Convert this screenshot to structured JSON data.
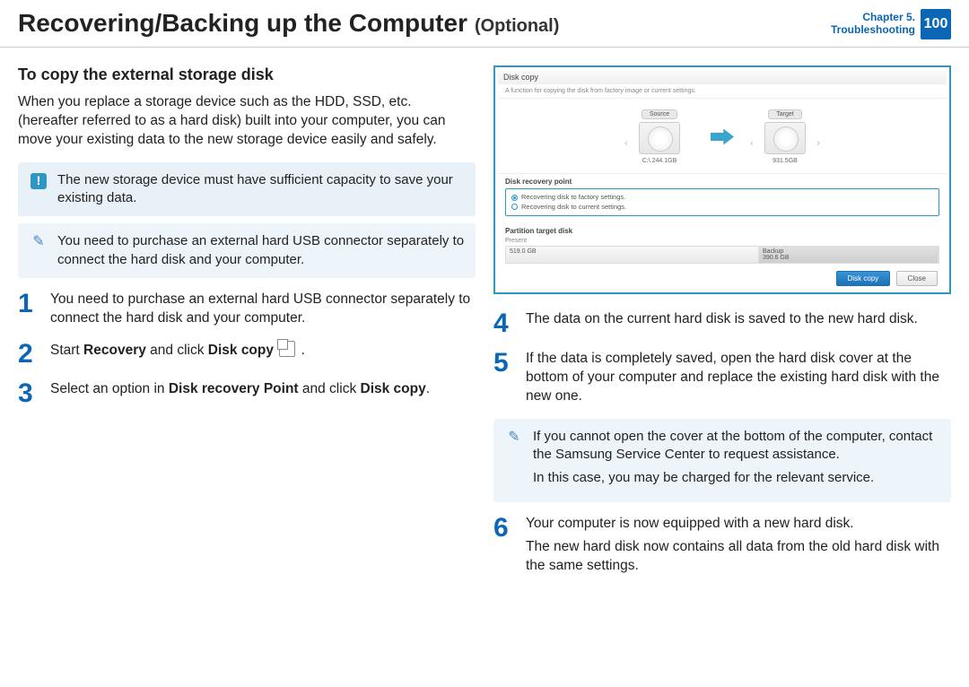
{
  "header": {
    "title": "Recovering/Backing up the Computer",
    "optional": "(Optional)",
    "chapter_line1": "Chapter 5.",
    "chapter_line2": "Troubleshooting",
    "page": "100"
  },
  "section_title": "To copy the external storage disk",
  "intro": "When you replace a storage device such as the HDD, SSD, etc. (hereafter referred to as a hard disk) built into your computer, you can move your existing data to the new storage device easily and safely.",
  "note_warning": "The new storage device must have sufficient capacity to save your existing data.",
  "note_purchase": "You need to purchase an external hard USB connector separately to connect the hard disk and your computer.",
  "steps": {
    "1": "You need to purchase an external hard USB connector separately to connect the hard disk and your computer.",
    "2_pre": "Start ",
    "2_bold1": "Recovery",
    "2_mid": " and click ",
    "2_bold2": "Disk copy",
    "2_post": " .",
    "3_pre": "Select an option in ",
    "3_bold1": "Disk recovery Point",
    "3_mid": " and click ",
    "3_bold2": "Disk copy",
    "3_post": ".",
    "4": "The data on the current hard disk is saved to the new hard disk.",
    "5": "If the data is completely saved, open the hard disk cover at the bottom of your computer and replace the existing hard disk with the new one.",
    "6a": "Your computer is now equipped with a new hard disk.",
    "6b": "The new hard disk now contains all data from the old hard disk with the same settings."
  },
  "note_bottom_a": "If you cannot open the cover at the bottom of the computer, contact the Samsung Service Center to request assistance.",
  "note_bottom_b": "In this case, you may be charged for the relevant service.",
  "shot": {
    "title": "Disk copy",
    "subtitle": "A function for copying the disk from factory image or current settings.",
    "source_label": "Source",
    "target_label": "Target",
    "source_cap": "C:\\ 244.1GB",
    "target_cap": "931.5GB",
    "recovery_head": "Disk recovery point",
    "opt1": "Recovering disk to factory settings.",
    "opt2": "Recovering disk to current settings.",
    "partition_head": "Partition target disk",
    "present": "Present",
    "seg1": "519.0 GB",
    "seg2_label": "Backup",
    "seg2": "390.6 GB",
    "btn_copy": "Disk copy",
    "btn_close": "Close"
  }
}
